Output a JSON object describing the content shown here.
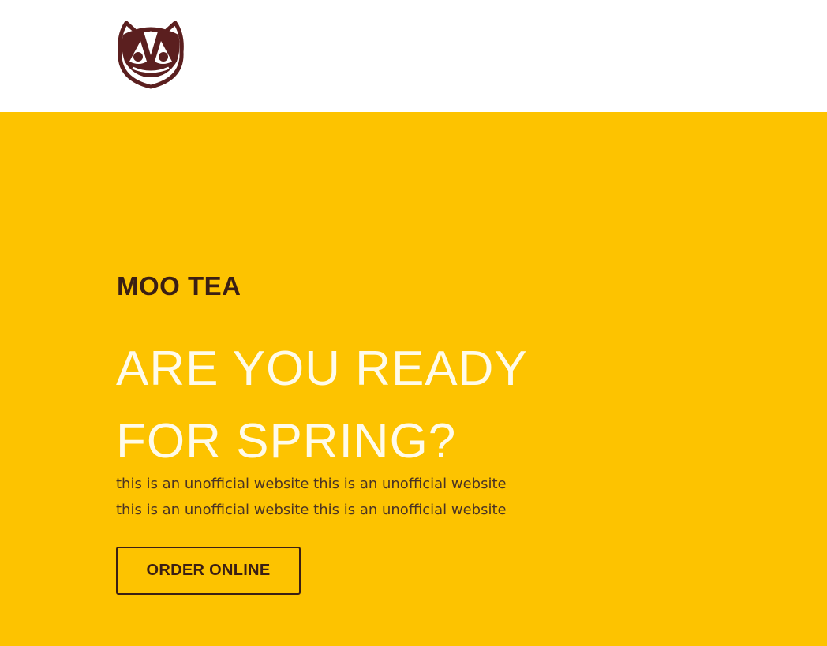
{
  "header": {
    "logo_icon": "cow-face-logo-icon",
    "logo_color": "#5b1f1f"
  },
  "hero": {
    "background_color": "#fdc300",
    "brand": "MOO TEA",
    "headline_line1": "ARE YOU READY",
    "headline_line2": "FOR SPRING?",
    "tagline_line1": "this is an unofficial website this is an unofficial website",
    "tagline_line2": "this is an unofficial website this is an unofficial website",
    "cta_label": "ORDER ONLINE"
  }
}
